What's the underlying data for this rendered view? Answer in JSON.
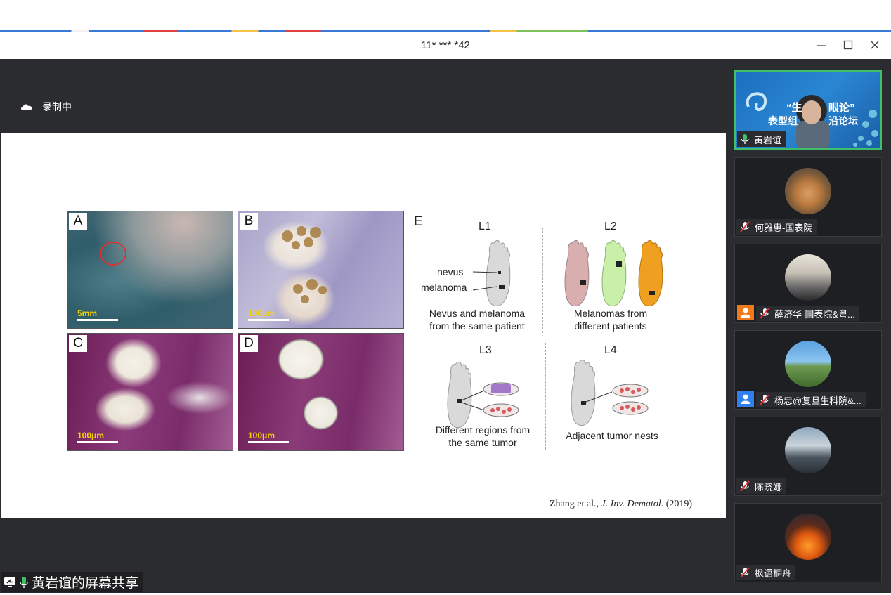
{
  "window": {
    "title": "11* *** *42"
  },
  "recording": {
    "label": "录制中"
  },
  "slide": {
    "panels": [
      {
        "label": "A",
        "scale": "5mm"
      },
      {
        "label": "B",
        "scale": "100μm"
      },
      {
        "label": "C",
        "scale": "100μm"
      },
      {
        "label": "D",
        "scale": "100μm"
      }
    ],
    "section_label": "E",
    "groups": [
      {
        "id": "L1",
        "caption": [
          "Nevus and melanoma",
          "from the same patient"
        ]
      },
      {
        "id": "L2",
        "caption": [
          "Melanomas from",
          "different patients"
        ]
      },
      {
        "id": "L3",
        "caption": [
          "Different regions from",
          "the same tumor"
        ]
      },
      {
        "id": "L4",
        "caption": [
          "Adjacent tumor nests"
        ]
      }
    ],
    "annotations": {
      "nevus": "nevus",
      "melanoma": "melanoma"
    },
    "citation": {
      "authors": "Zhang et al., ",
      "journal": "J. Inv. Dematol.",
      "year": " (2019)"
    },
    "colors": {
      "foot_gray": "#d9d9d9",
      "foot_pink": "#d8aeae",
      "foot_green": "#c8f0a8",
      "foot_orange": "#f0a020"
    }
  },
  "share": {
    "label": "黄岩谊的屏幕共享"
  },
  "participants": [
    {
      "name": "黄岩谊",
      "mic": "mic-on-icon",
      "active": true,
      "banner": {
        "line1": "“生",
        "line2": "眼论”",
        "line3": "表型组",
        "line4": "沿论坛"
      }
    },
    {
      "name": "何雅惠-国表院",
      "mic": "mic-muted-icon"
    },
    {
      "name": "薛济华-国表院&粤...",
      "mic": "mic-muted-icon",
      "badge": "orange"
    },
    {
      "name": "杨忠@复旦生科院&...",
      "mic": "mic-muted-icon",
      "badge": "blue"
    },
    {
      "name": "陈晓娜",
      "mic": "mic-muted-icon"
    },
    {
      "name": "枫语桐舟",
      "mic": "mic-muted-icon"
    }
  ]
}
